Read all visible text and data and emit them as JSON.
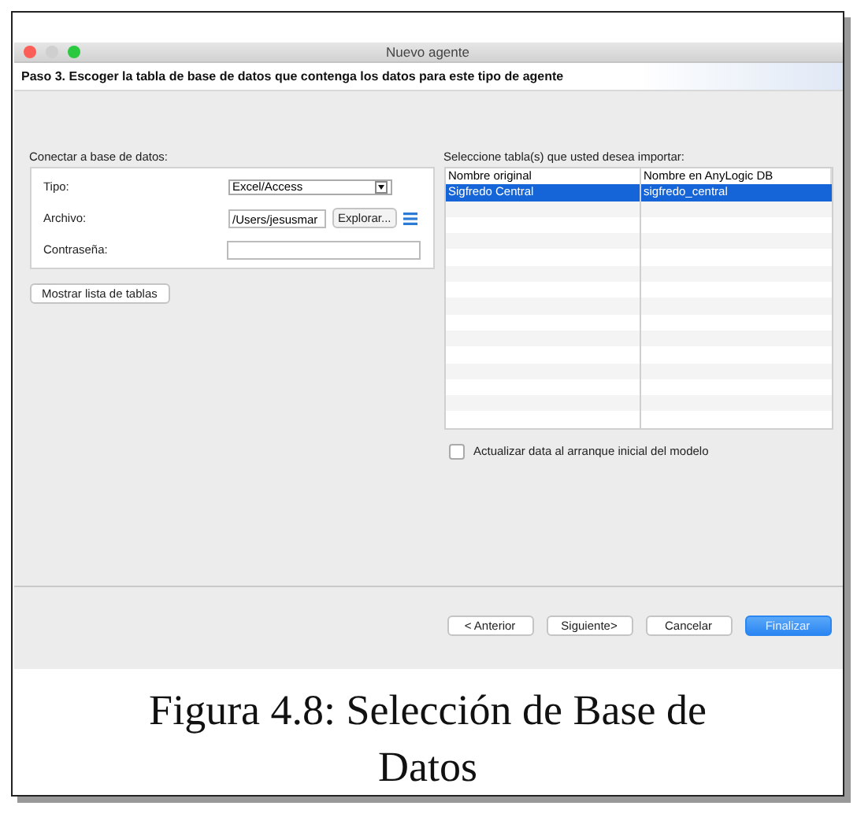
{
  "window": {
    "title": "Nuevo agente"
  },
  "step": "Paso 3. Escoger la tabla de base de datos que contenga los datos para este tipo de agente",
  "connection": {
    "heading": "Conectar a base de datos:",
    "fields": [
      {
        "kind": "dropdown",
        "label": "Tipo:",
        "value": "Excel/Access"
      },
      {
        "kind": "file",
        "label": "Archivo:",
        "value": "/Users/jesusmar",
        "button": "Explorar..."
      },
      {
        "kind": "password",
        "label": "Contraseña:"
      }
    ],
    "show_button": "Mostrar lista de tablas"
  },
  "tables": {
    "heading": "Seleccione tabla(s) que usted desea importar:",
    "columns": [
      "Nombre original",
      "Nombre en AnyLogic DB"
    ],
    "rows": [
      {
        "cells": [
          "Sigfredo Central",
          "sigfredo_central"
        ],
        "selected": true
      }
    ]
  },
  "update_option": {
    "label": "Actualizar data al arranque inicial del modelo",
    "checked": false
  },
  "buttons": [
    {
      "label": "< Anterior",
      "primary": false
    },
    {
      "label": "Siguiente>",
      "primary": false
    },
    {
      "label": "Cancelar",
      "primary": false
    },
    {
      "label": "Finalizar",
      "primary": true
    }
  ],
  "caption": "Figura 4.8: Selección de Base de Datos"
}
